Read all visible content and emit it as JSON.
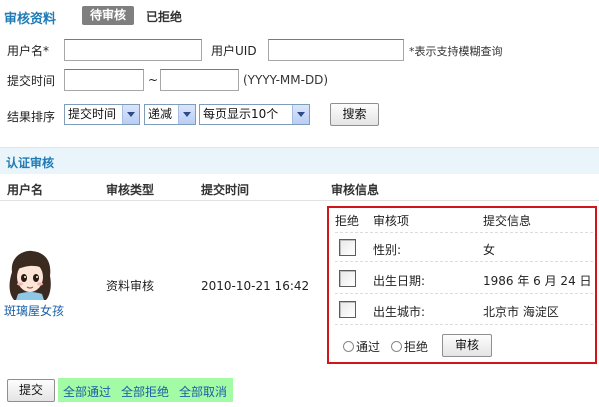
{
  "header": {
    "title": "审核资料",
    "tab_pending": "待审核",
    "tab_rejected": "已拒绝"
  },
  "filters": {
    "username_label": "用户名*",
    "username_value": "",
    "uid_label": "用户UID",
    "uid_value": "",
    "fuzzy_hint": "*表示支持模糊查询",
    "submit_time_label": "提交时间",
    "date_from": "",
    "date_to": "",
    "date_separator": "~",
    "date_format_hint": "(YYYY-MM-DD)",
    "sort_label": "结果排序",
    "sort_field": "提交时间",
    "sort_order": "递减",
    "page_size": "每页显示10个",
    "search_button": "搜索"
  },
  "section": {
    "title": "认证审核"
  },
  "table": {
    "columns": [
      "用户名",
      "审核类型",
      "提交时间",
      "审核信息"
    ],
    "row": {
      "username": "斑璃屋女孩",
      "type": "资料审核",
      "time": "2010-10-21 16:42"
    }
  },
  "review": {
    "headers": [
      "拒绝",
      "审核项",
      "提交信息"
    ],
    "items": [
      {
        "label": "性别:",
        "value": "女",
        "rejected": false
      },
      {
        "label": "出生日期:",
        "value": "1986 年 6 月 24 日",
        "rejected": false
      },
      {
        "label": "出生城市:",
        "value": "北京市 海淀区",
        "rejected": false
      }
    ],
    "pass_label": "通过",
    "reject_label": "拒绝",
    "audit_button": "审核"
  },
  "footer": {
    "submit_button": "提交",
    "approve_all": "全部通过",
    "reject_all": "全部拒绝",
    "cancel_all": "全部取消"
  },
  "colors": {
    "accent": "#1f7bb6",
    "highlight_border": "#d0161b",
    "green_bar": "#a4fba5"
  }
}
